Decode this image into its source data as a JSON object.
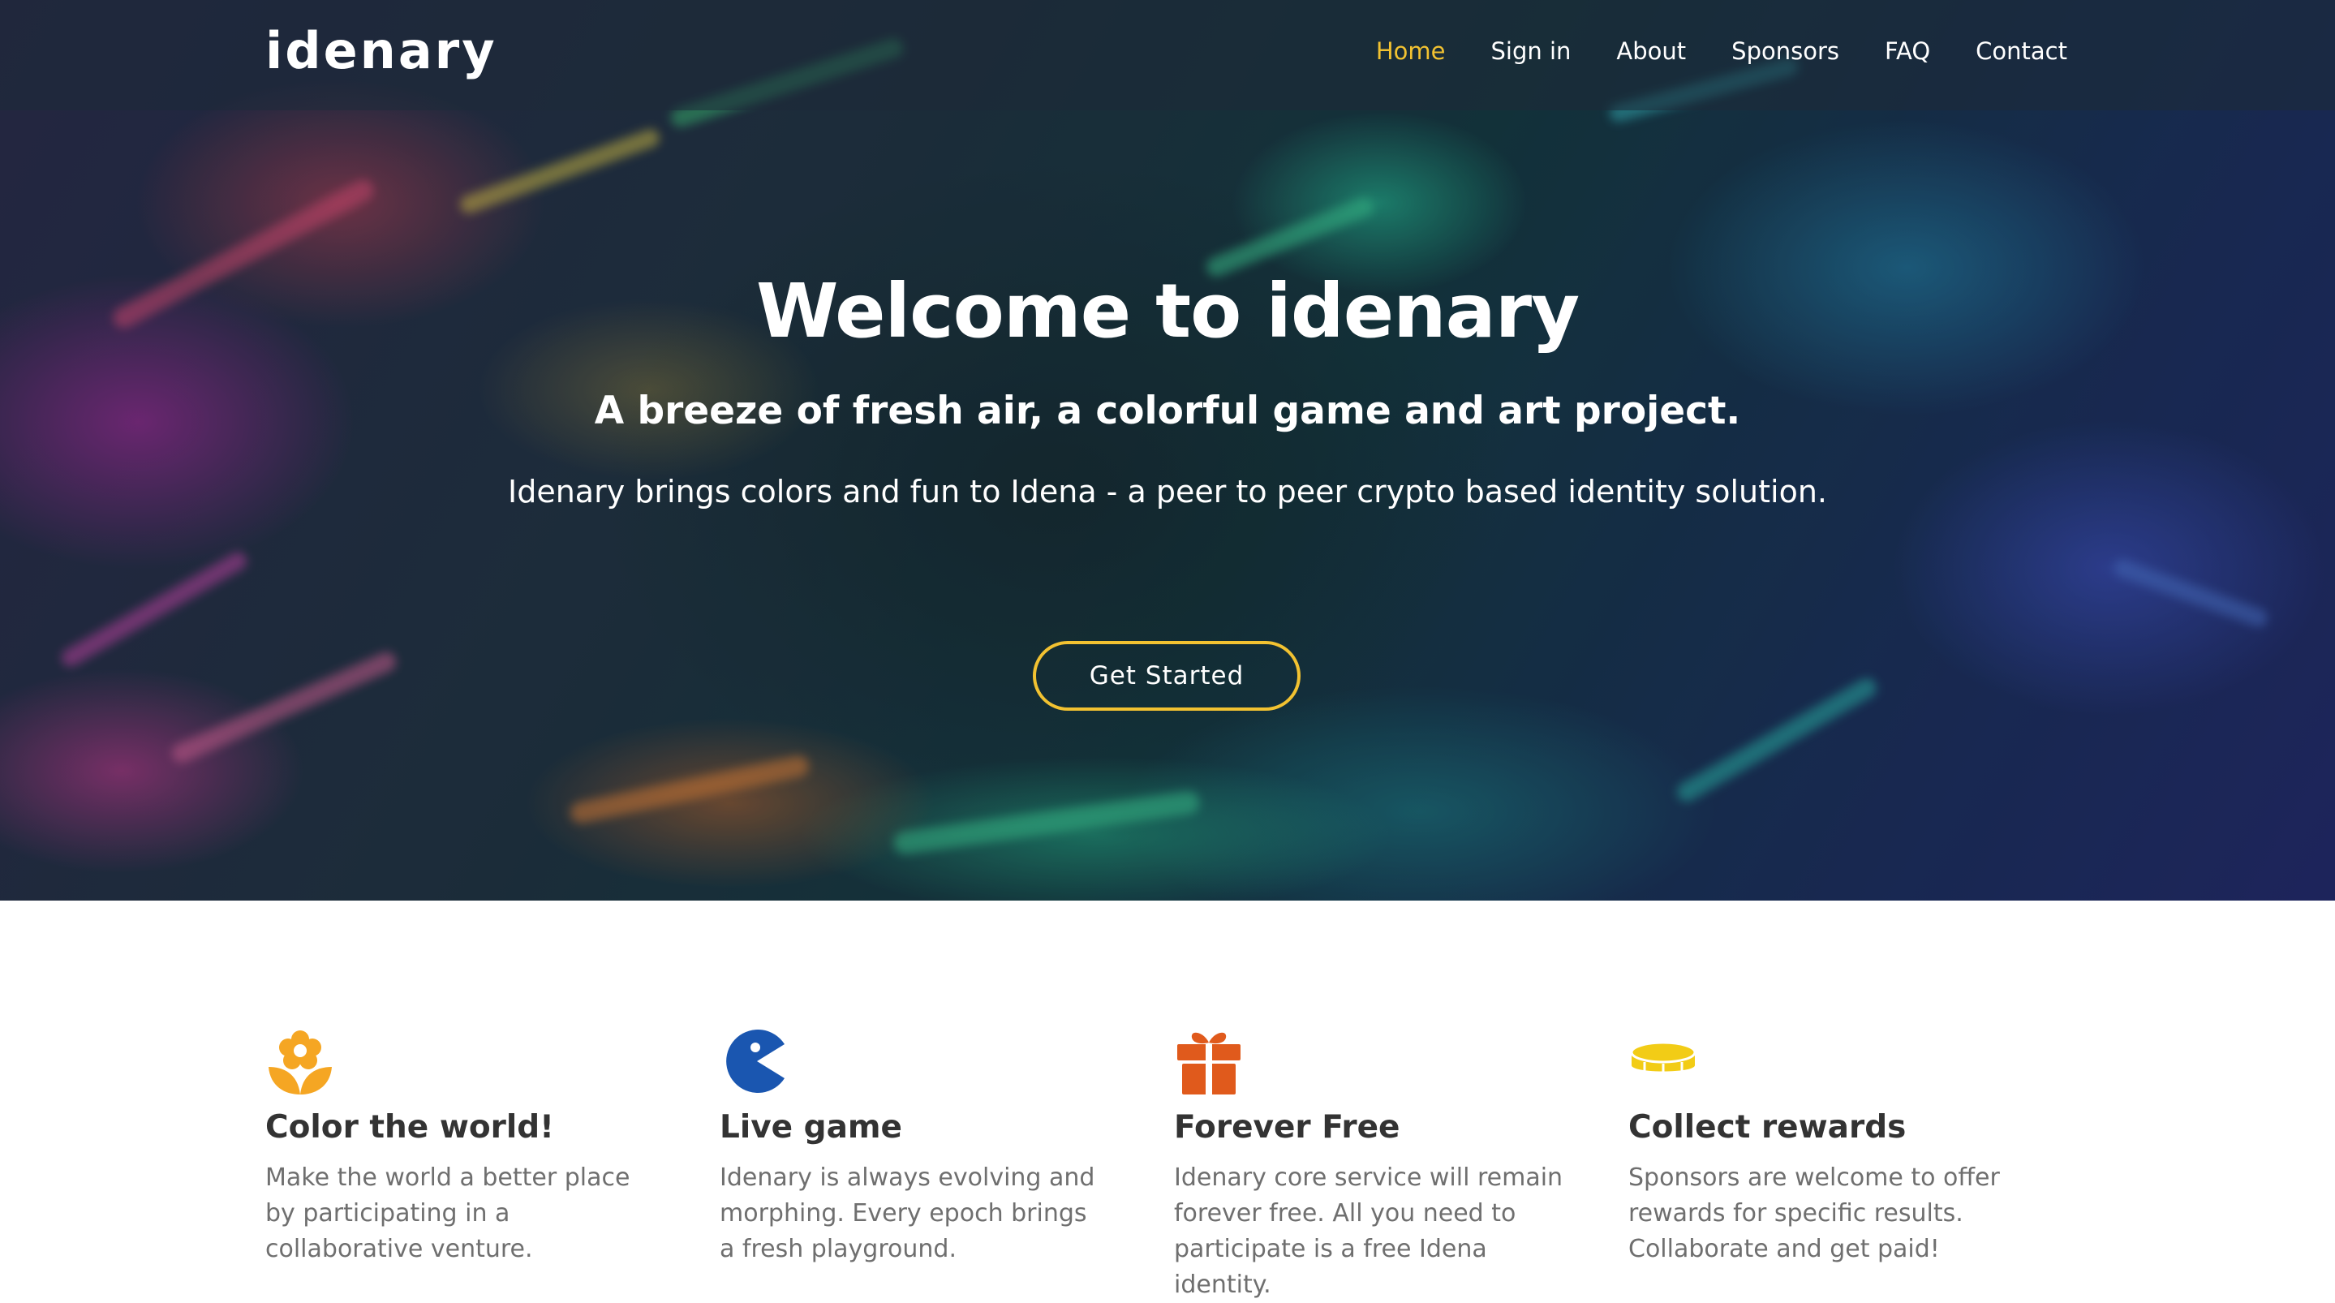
{
  "brand": "idenary",
  "nav": {
    "items": [
      {
        "label": "Home",
        "active": true
      },
      {
        "label": "Sign in",
        "active": false
      },
      {
        "label": "About",
        "active": false
      },
      {
        "label": "Sponsors",
        "active": false
      },
      {
        "label": "FAQ",
        "active": false
      },
      {
        "label": "Contact",
        "active": false
      }
    ]
  },
  "hero": {
    "title": "Welcome to idenary",
    "subtitle": "A breeze of fresh air, a colorful game and art project.",
    "description": "Idenary brings colors and fun to Idena - a peer to peer crypto based identity solution.",
    "cta_label": "Get Started"
  },
  "features": [
    {
      "icon": "flower-icon",
      "icon_color": "#f5a623",
      "title": "Color the world!",
      "text": "Make the world a better place by participating in a collaborative venture."
    },
    {
      "icon": "pacman-icon",
      "icon_color": "#1a56b0",
      "title": "Live game",
      "text": "Idenary is always evolving and morphing. Every epoch brings a fresh playground."
    },
    {
      "icon": "gift-icon",
      "icon_color": "#e05a1c",
      "title": "Forever Free",
      "text": "Idenary core service will remain forever free. All you need to participate is a free Idena identity."
    },
    {
      "icon": "coins-icon",
      "icon_color": "#f2cc16",
      "title": "Collect rewards",
      "text": "Sponsors are welcome to offer rewards for specific results. Collaborate and get paid!"
    }
  ],
  "colors": {
    "accent": "#f2c231",
    "heading": "#333333",
    "body_text": "#6f6f6f"
  }
}
